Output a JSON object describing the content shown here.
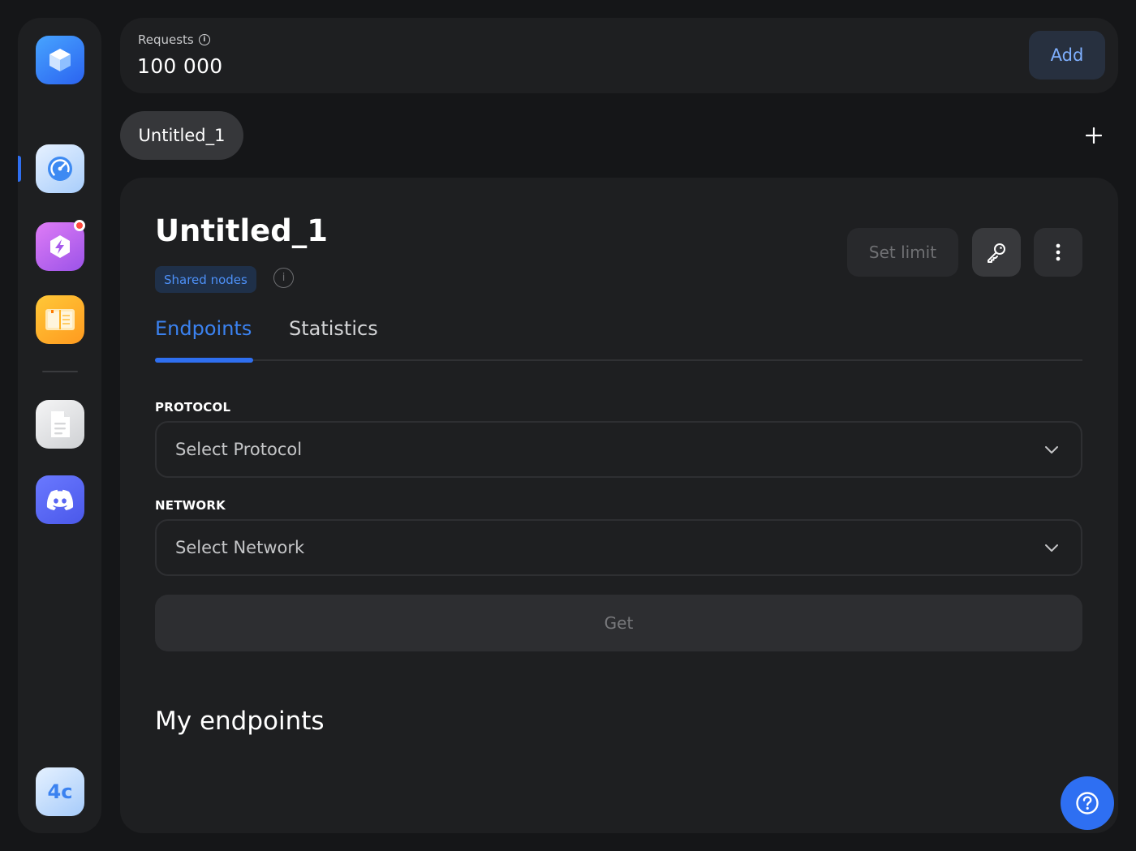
{
  "sidebar": {
    "items": [
      {
        "name": "app-logo",
        "icon": "cube-icon"
      },
      {
        "name": "dashboard",
        "icon": "speedometer-icon",
        "active": true
      },
      {
        "name": "boost",
        "icon": "lightning-icon",
        "has_notification": true
      },
      {
        "name": "docs-book",
        "icon": "book-icon"
      },
      {
        "name": "documents",
        "icon": "document-icon"
      },
      {
        "name": "discord",
        "icon": "discord-icon"
      }
    ],
    "bottom_label": "4c"
  },
  "header": {
    "requests_label": "Requests",
    "requests_value": "100 000",
    "add_label": "Add"
  },
  "project_tabs": [
    {
      "label": "Untitled_1",
      "active": true
    }
  ],
  "project": {
    "title": "Untitled_1",
    "badge": "Shared nodes",
    "set_limit_label": "Set limit"
  },
  "tabs": [
    {
      "label": "Endpoints",
      "active": true
    },
    {
      "label": "Statistics",
      "active": false
    }
  ],
  "form": {
    "protocol_label": "PROTOCOL",
    "protocol_placeholder": "Select Protocol",
    "network_label": "NETWORK",
    "network_placeholder": "Select Network",
    "get_label": "Get"
  },
  "my_endpoints_title": "My endpoints",
  "colors": {
    "accent": "#2f6ff0",
    "background": "#151618",
    "card": "#1e1f21"
  }
}
